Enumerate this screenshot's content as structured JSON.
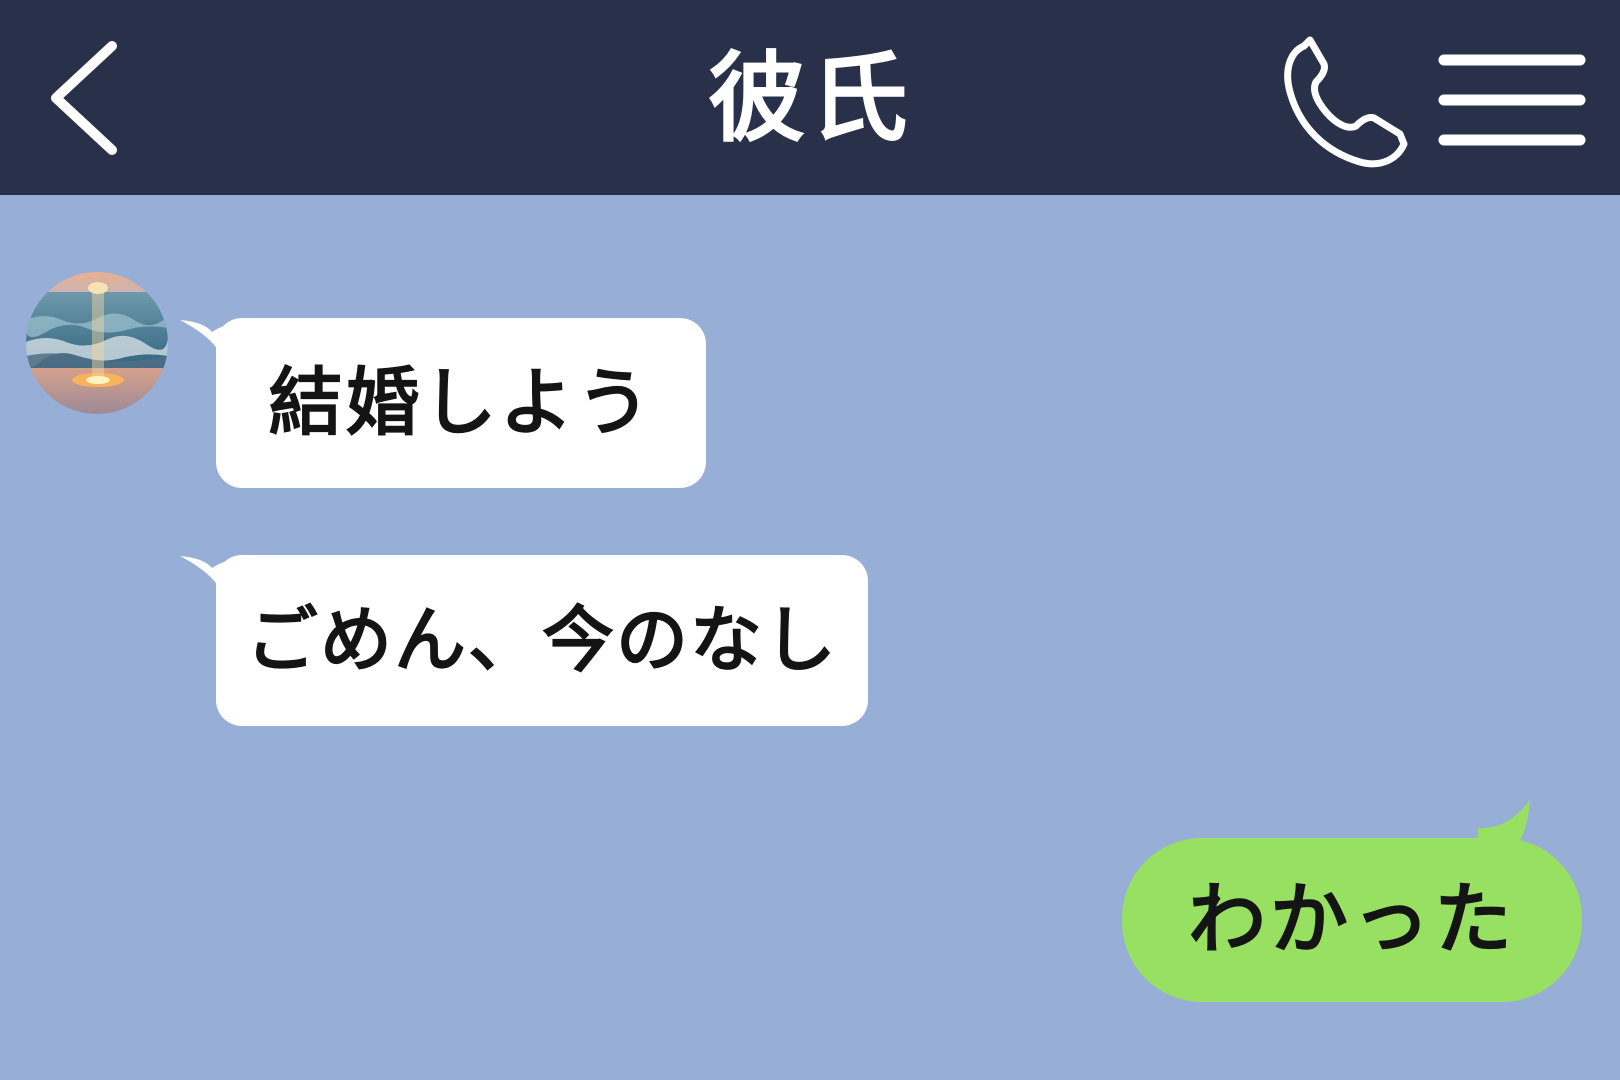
{
  "header": {
    "title": "彼氏",
    "back_icon": "chevron-left-icon",
    "call_icon": "phone-icon",
    "menu_icon": "hamburger-menu-icon"
  },
  "colors": {
    "header_bg": "#283149",
    "chat_bg": "#97aed6",
    "incoming_bubble": "#ffffff",
    "outgoing_bubble": "#98e061",
    "text": "#141414"
  },
  "messages": [
    {
      "direction": "incoming",
      "text": "結婚しよう"
    },
    {
      "direction": "incoming",
      "text": "ごめん、今のなし"
    },
    {
      "direction": "outgoing",
      "text": "わかった"
    }
  ],
  "contact": {
    "avatar_icon": "avatar-sunset-sea"
  }
}
